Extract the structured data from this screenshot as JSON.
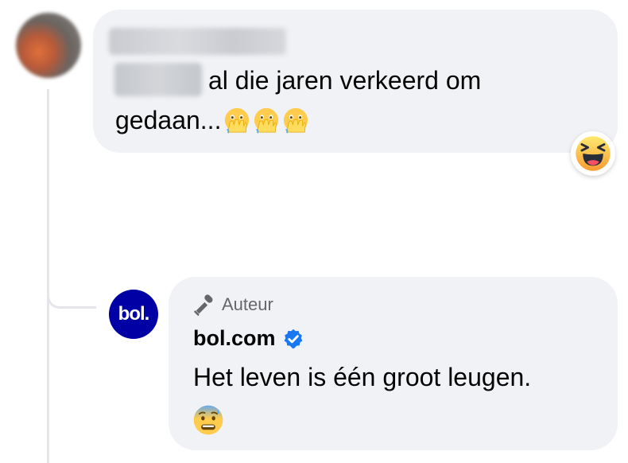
{
  "comment": {
    "author_name": "",
    "mention": "",
    "text_line1": "al die jaren verkeerd om",
    "text_line2": "gedaan...",
    "emojis": [
      "face-with-open-eyes-and-hand-over-mouth",
      "face-with-open-eyes-and-hand-over-mouth",
      "face-with-open-eyes-and-hand-over-mouth"
    ],
    "reaction": "haha-reaction-icon"
  },
  "reply": {
    "badge_label": "Auteur",
    "badge_icon": "microphone-icon",
    "page_name": "bol.com",
    "verified_icon": "verified-badge-icon",
    "avatar_text": "bol.",
    "text": "Het leven is één groot leugen.",
    "emoji": "anxious-face-with-sweat"
  },
  "colors": {
    "bubble": "#f0f2f5",
    "verified": "#1877f2",
    "bol_brand": "#0000a4",
    "secondary_text": "#65676b"
  }
}
